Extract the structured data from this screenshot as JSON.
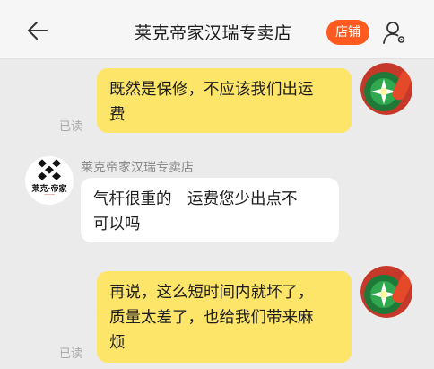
{
  "header": {
    "title": "莱克帝家汉瑞专卖店",
    "store_button": "店铺",
    "back_icon": "back-arrow-icon",
    "profile_icon": "user-settings-icon"
  },
  "colors": {
    "accent": "#ff5a1f",
    "my_bubble": "#fde56a",
    "their_bubble": "#ffffff",
    "background": "#ebebeb"
  },
  "messages": [
    {
      "from": "me",
      "text_line1": "既然是保修，不应该我们出运",
      "text_line2": "费",
      "status": "已读"
    },
    {
      "from": "shop",
      "sender": "莱克帝家汉瑞专卖店",
      "text_line1": "气杆很重的　运费您少出点不",
      "text_line2": "可以吗",
      "logo_text": "莱克·帝家"
    },
    {
      "from": "me",
      "text_line1": "再说，这么短时间内就坏了，",
      "text_line2": "质量太差了，也给我们带来麻",
      "text_line3": "烦",
      "status": "已读"
    }
  ]
}
